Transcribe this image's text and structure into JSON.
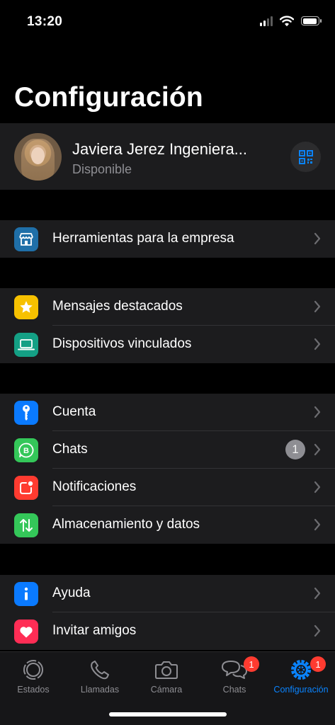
{
  "status_bar": {
    "time": "13:20"
  },
  "header": {
    "title": "Configuración"
  },
  "profile": {
    "name": "Javiera Jerez Ingeniera...",
    "status": "Disponible"
  },
  "sections": [
    {
      "items": [
        {
          "label": "Herramientas para la empresa",
          "icon": "storefront-icon",
          "color": "#1f6fa8"
        }
      ]
    },
    {
      "items": [
        {
          "label": "Mensajes destacados",
          "icon": "star-icon",
          "color": "#f7c100"
        },
        {
          "label": "Dispositivos vinculados",
          "icon": "laptop-icon",
          "color": "#14a085"
        }
      ]
    },
    {
      "items": [
        {
          "label": "Cuenta",
          "icon": "key-icon",
          "color": "#0a7aff"
        },
        {
          "label": "Chats",
          "icon": "whatsapp-business-icon",
          "color": "#34c759",
          "badge": "1"
        },
        {
          "label": "Notificaciones",
          "icon": "notification-icon",
          "color": "#ff3b30"
        },
        {
          "label": "Almacenamiento y datos",
          "icon": "data-arrows-icon",
          "color": "#34c759"
        }
      ]
    },
    {
      "items": [
        {
          "label": "Ayuda",
          "icon": "info-icon",
          "color": "#0a7aff"
        },
        {
          "label": "Invitar amigos",
          "icon": "heart-icon",
          "color": "#ff2d55"
        }
      ]
    }
  ],
  "tab_bar": {
    "tabs": [
      {
        "label": "Estados",
        "icon": "status-icon"
      },
      {
        "label": "Llamadas",
        "icon": "phone-icon"
      },
      {
        "label": "Cámara",
        "icon": "camera-icon"
      },
      {
        "label": "Chats",
        "icon": "chat-bubbles-icon",
        "badge": "1"
      },
      {
        "label": "Configuración",
        "icon": "settings-gear-icon",
        "badge": "1",
        "active": true
      }
    ],
    "active_color": "#0a84ff"
  }
}
